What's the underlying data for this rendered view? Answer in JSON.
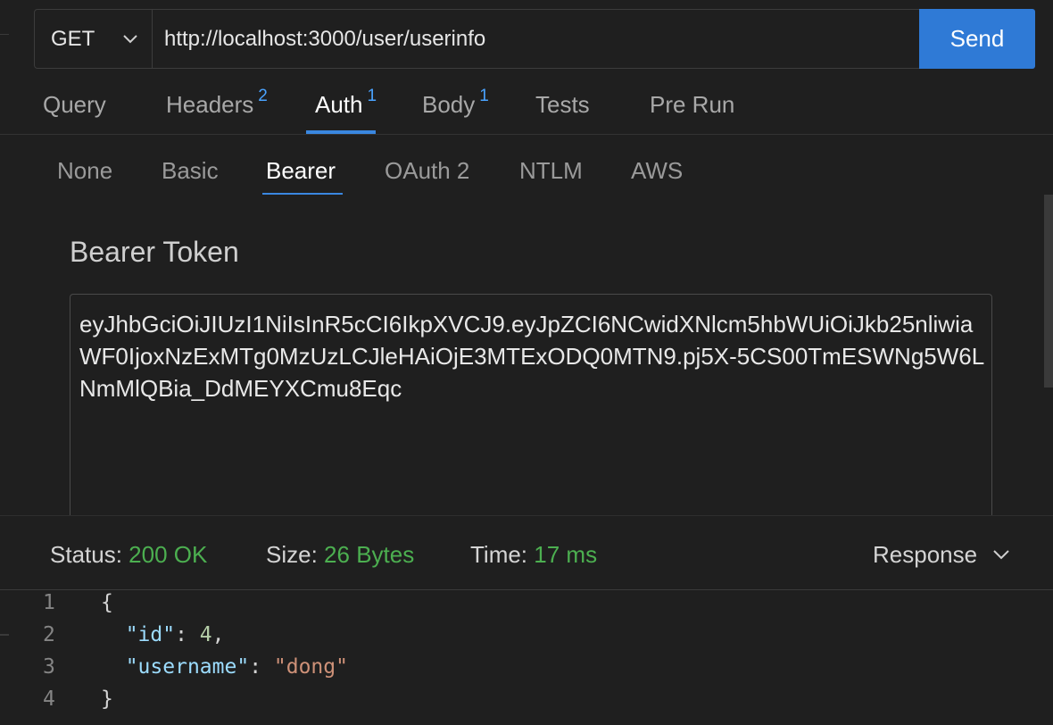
{
  "request": {
    "method": "GET",
    "url": "http://localhost:3000/user/userinfo",
    "send_label": "Send"
  },
  "tabs": [
    {
      "label": "Query",
      "badge": ""
    },
    {
      "label": "Headers",
      "badge": "2"
    },
    {
      "label": "Auth",
      "badge": "1"
    },
    {
      "label": "Body",
      "badge": "1"
    },
    {
      "label": "Tests",
      "badge": ""
    },
    {
      "label": "Pre Run",
      "badge": ""
    }
  ],
  "active_tab": "Auth",
  "auth": {
    "types": [
      "None",
      "Basic",
      "Bearer",
      "OAuth 2",
      "NTLM",
      "AWS"
    ],
    "active_type": "Bearer",
    "token_label": "Bearer Token",
    "token": "eyJhbGciOiJIUzI1NiIsInR5cCI6IkpXVCJ9.eyJpZCI6NCwidXNlcm5hbWUiOiJkb25nliwiaWF0IjoxNzExMTg0MzUzLCJleHAiOjE3MTExODQ0MTN9.pj5X-5CS00TmESWNg5W6LNmMlQBia_DdMEYXCmu8Eqc"
  },
  "response": {
    "status_label": "Status:",
    "status_value": "200 OK",
    "size_label": "Size:",
    "size_value": "26 Bytes",
    "time_label": "Time:",
    "time_value": "17 ms",
    "view_select": "Response",
    "lines": [
      {
        "num": "1",
        "text": "{"
      },
      {
        "num": "2",
        "key": "\"id\"",
        "value": "4",
        "trail": ","
      },
      {
        "num": "3",
        "key": "\"username\"",
        "value": "\"dong\"",
        "trail": ""
      },
      {
        "num": "4",
        "text": "}"
      }
    ]
  },
  "colors": {
    "accent": "#2f7ad6",
    "status_ok": "#4caf50",
    "badge": "#4aa3ff"
  },
  "icons": {
    "method_dropdown": "chevron-down-icon",
    "response_dropdown": "chevron-down-icon"
  }
}
